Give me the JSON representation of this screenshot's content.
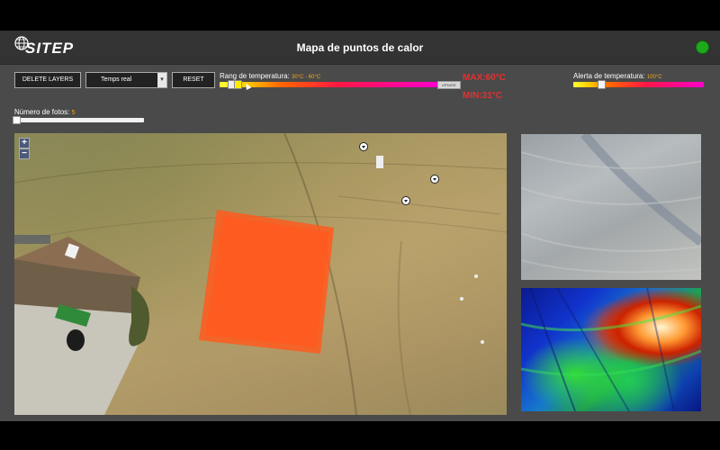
{
  "header": {
    "logo_text": "SITEP",
    "title": "Mapa de puntos de calor",
    "status_color": "#1ea81e"
  },
  "toolbar": {
    "delete_label": "DELETE LAYERS",
    "mode_value": "Temps real",
    "reset_label": "RESET"
  },
  "temperature_range": {
    "label": "Rang de temperatura:",
    "value": "30°C - 60°C",
    "update_label": "UPDATE",
    "min_fraction": 0.04,
    "max_fraction": 0.07
  },
  "readouts": {
    "max": "MAX:60°C",
    "min": "MIN:31°C"
  },
  "temperature_alert": {
    "label": "Alerta de temperatura:",
    "value": "100°C",
    "fraction": 0.2
  },
  "photos": {
    "label": "Número de fotos:",
    "value": "5",
    "fraction": 0
  },
  "map": {
    "zoom_in": "+",
    "zoom_out": "−",
    "heat_color": "#ff5a1f"
  },
  "icons": [
    "globe-logo-icon",
    "chevron-down-icon",
    "map-pin-icon",
    "cursor-icon"
  ]
}
